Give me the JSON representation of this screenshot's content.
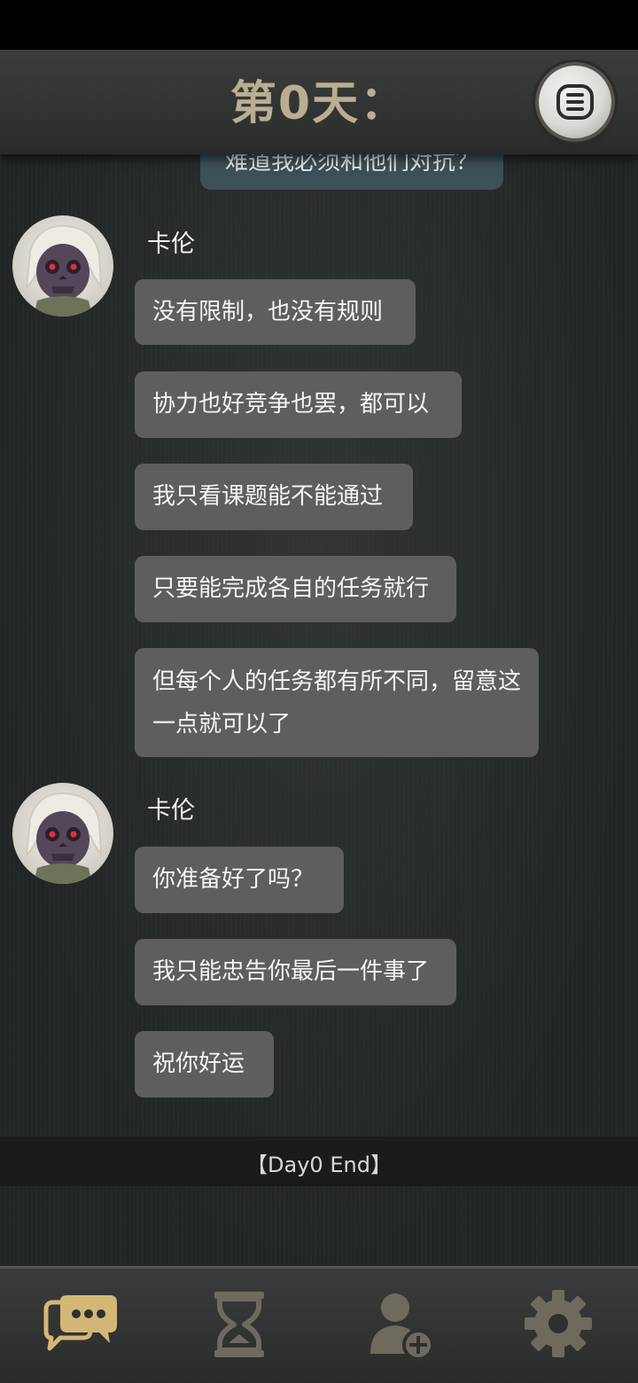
{
  "header": {
    "title": "第0天："
  },
  "previous_message": {
    "text": "难道我必须和他们对抗？"
  },
  "groups": [
    {
      "sender": "卡伦",
      "messages": [
        "没有限制，也没有规则",
        "协力也好竞争也罢，都可以",
        "我只看课题能不能通过",
        "只要能完成各自的任务就行",
        "但每个人的任务都有所不同，留意这一点就可以了"
      ]
    },
    {
      "sender": "卡伦",
      "messages": [
        "你准备好了吗？",
        "我只能忠告你最后一件事了",
        "祝你好运"
      ]
    }
  ],
  "day_end": "【Day0 End】",
  "nav": {
    "items": [
      {
        "icon": "chat-icon",
        "active": true
      },
      {
        "icon": "hourglass-icon",
        "active": false
      },
      {
        "icon": "add-contact-icon",
        "active": false
      },
      {
        "icon": "gear-icon",
        "active": false
      }
    ]
  },
  "colors": {
    "accent_active": "#d4b777",
    "icon_inactive": "#6e6a5e",
    "bubble": "#5e5e5e",
    "title": "#b9ad92"
  }
}
